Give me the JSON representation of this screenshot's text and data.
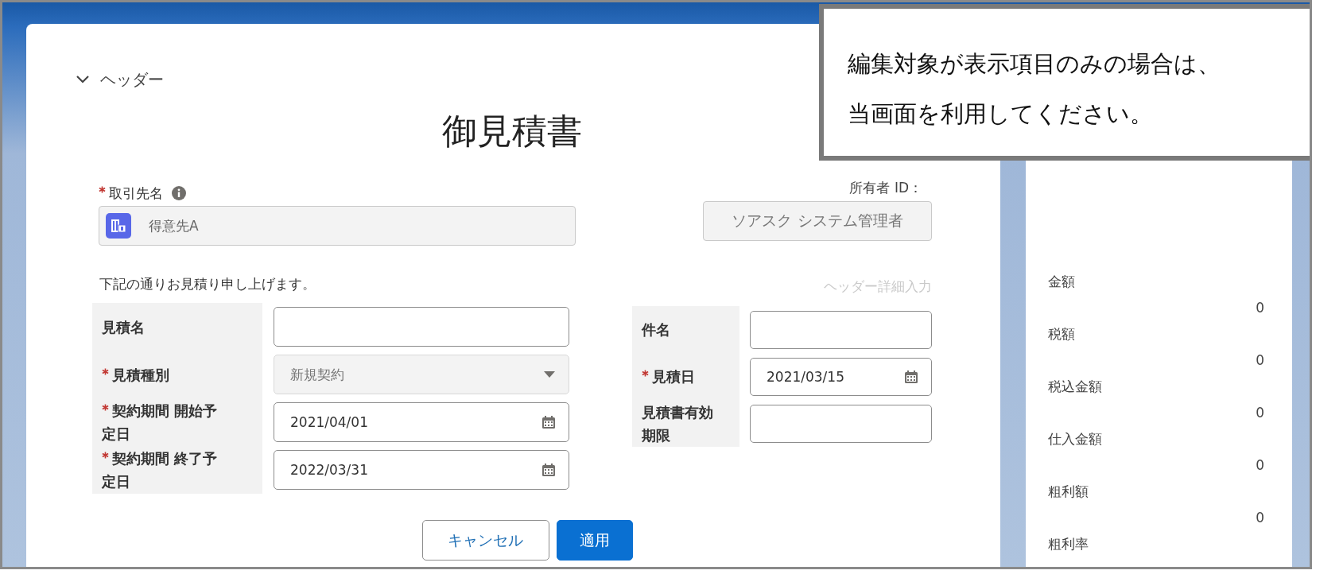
{
  "header_section": {
    "label": "ヘッダー",
    "expanded": true
  },
  "title": "御見積書",
  "account": {
    "label": "取引先名",
    "required": true,
    "value": "得意先A",
    "disabled": true
  },
  "owner": {
    "label": "所有者 ID：",
    "value": "ソアスク システム管理者",
    "disabled": true
  },
  "intro": "下記の通りお見積り申し上げます。",
  "detail_link": "ヘッダー詳細入力",
  "left_fields": [
    {
      "kind": "text",
      "label": "見積名",
      "required": false
    },
    {
      "kind": "select",
      "label": "見積種別",
      "required": true,
      "value": "新規契約",
      "disabled": true
    },
    {
      "kind": "date",
      "label": "契約期間 開始予定日",
      "required": true,
      "value": "2021/04/01"
    },
    {
      "kind": "date",
      "label": "契約期間 終了予定日",
      "required": true,
      "value": "2022/03/31"
    }
  ],
  "right_fields": [
    {
      "kind": "text",
      "label": "件名",
      "required": false
    },
    {
      "kind": "date",
      "label": "見積日",
      "required": true,
      "value": "2021/03/15"
    },
    {
      "kind": "text",
      "label": "見積書有効期限",
      "required": false
    }
  ],
  "buttons": [
    {
      "kind": "secondary",
      "label": "キャンセル"
    },
    {
      "kind": "primary",
      "label": "適用"
    }
  ],
  "summary": [
    {
      "label": "金額",
      "value": "0"
    },
    {
      "label": "税額",
      "value": "0"
    },
    {
      "label": "税込金額",
      "value": "0"
    },
    {
      "label": "仕入金額",
      "value": "0"
    },
    {
      "label": "粗利額",
      "value": "0"
    },
    {
      "label": "粗利率"
    }
  ],
  "callout": {
    "lines": [
      "編集対象が表示項目のみの場合は、",
      "当画面を利用してください。"
    ]
  }
}
